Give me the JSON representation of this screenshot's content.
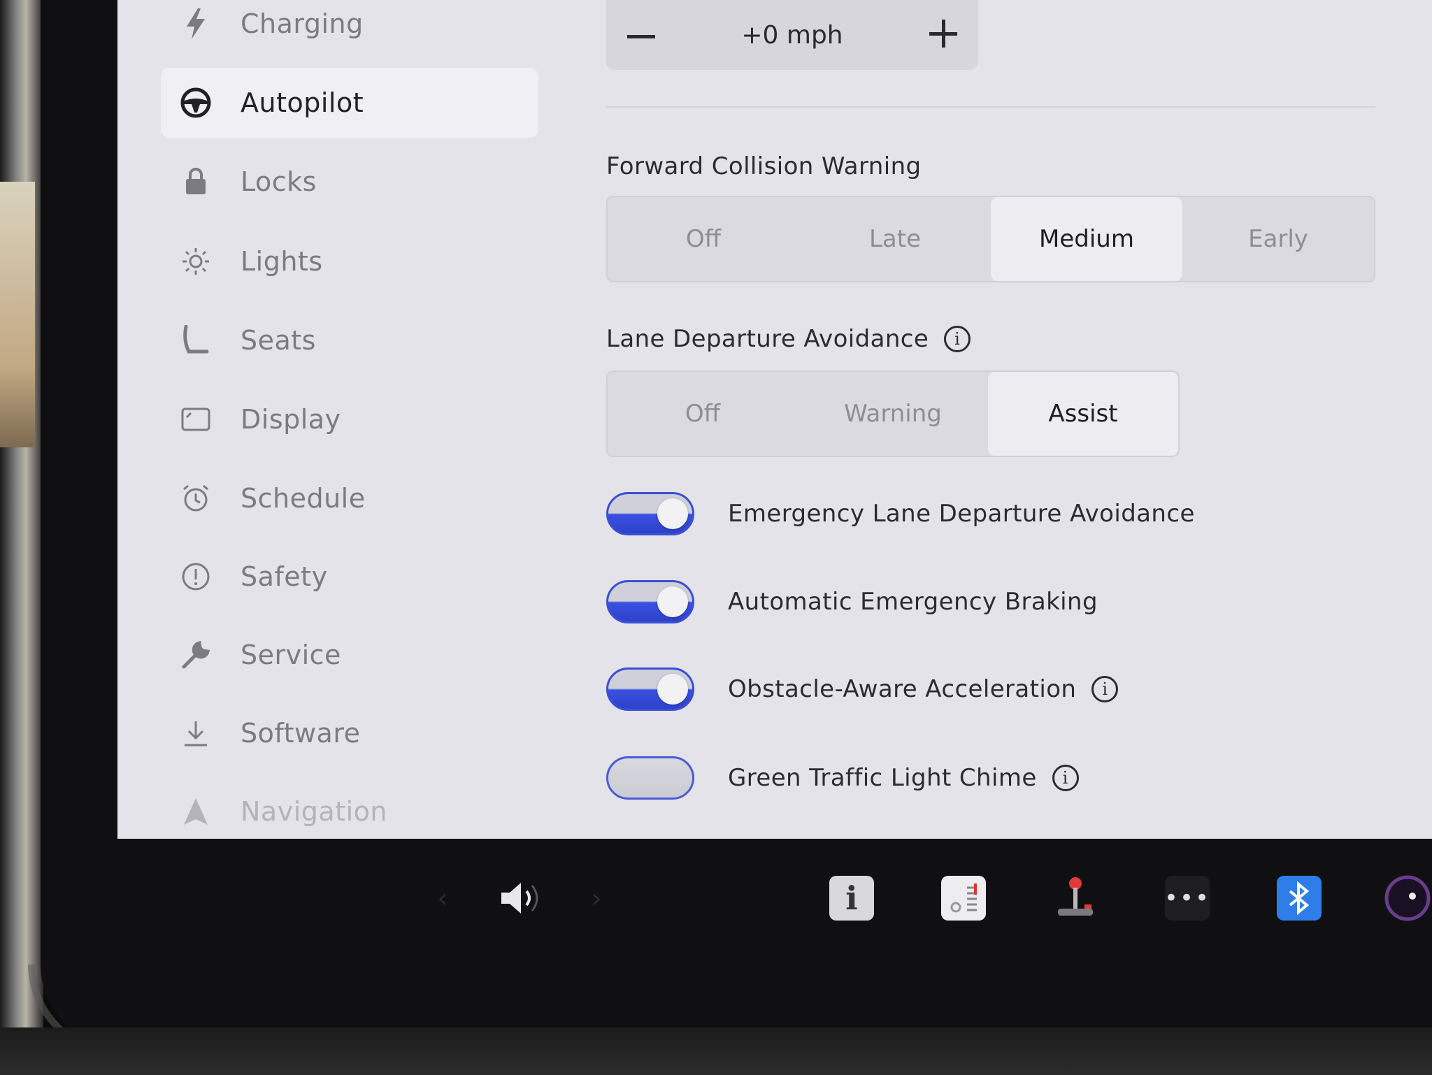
{
  "sidebar": {
    "items": [
      {
        "label": "Charging",
        "icon": "bolt-icon"
      },
      {
        "label": "Autopilot",
        "icon": "steering-wheel-icon",
        "active": true
      },
      {
        "label": "Locks",
        "icon": "lock-icon"
      },
      {
        "label": "Lights",
        "icon": "light-icon"
      },
      {
        "label": "Seats",
        "icon": "seat-icon"
      },
      {
        "label": "Display",
        "icon": "display-icon"
      },
      {
        "label": "Schedule",
        "icon": "alarm-clock-icon"
      },
      {
        "label": "Safety",
        "icon": "alert-circle-icon"
      },
      {
        "label": "Service",
        "icon": "wrench-icon"
      },
      {
        "label": "Software",
        "icon": "download-icon"
      },
      {
        "label": "Navigation",
        "icon": "navigation-arrow-icon"
      }
    ]
  },
  "speed_offset": {
    "value": "+0 mph",
    "decrement_icon": "minus-icon",
    "increment_icon": "plus-icon"
  },
  "forward_collision_warning": {
    "title": "Forward Collision Warning",
    "options": [
      "Off",
      "Late",
      "Medium",
      "Early"
    ],
    "selected": "Medium"
  },
  "lane_departure_avoidance": {
    "title": "Lane Departure Avoidance",
    "options": [
      "Off",
      "Warning",
      "Assist"
    ],
    "selected": "Assist"
  },
  "toggles": [
    {
      "label": "Emergency Lane Departure Avoidance",
      "on": true,
      "info": false
    },
    {
      "label": "Automatic Emergency Braking",
      "on": true,
      "info": false
    },
    {
      "label": "Obstacle-Aware Acceleration",
      "on": true,
      "info": true
    },
    {
      "label": "Green Traffic Light Chime",
      "on": false,
      "info": true
    }
  ],
  "taskbar": {
    "items": [
      "chevron-left-icon",
      "volume-icon",
      "chevron-right-icon",
      "manual-app-icon",
      "calendar-app-icon",
      "joystick-app-icon",
      "more-icon",
      "bluetooth-icon",
      "camera-icon"
    ]
  },
  "colors": {
    "accent_blue": "#3b50e0",
    "bluetooth_tile": "#2f7de8",
    "screen_bg": "#e3e3e9"
  }
}
